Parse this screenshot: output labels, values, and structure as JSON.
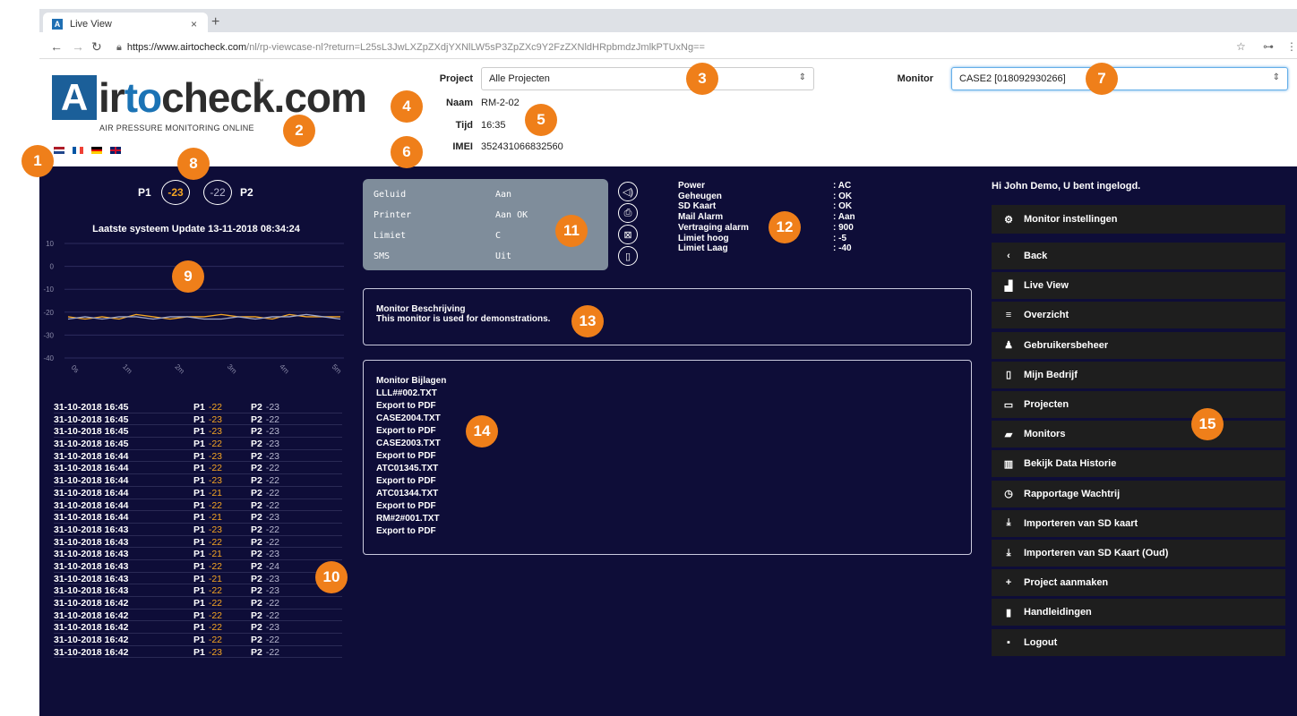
{
  "browser": {
    "tab_title": "Live View",
    "tab_favicon": "A",
    "url_domain": "https://www.airtocheck.com",
    "url_path": "/nl/rp-viewcase-nl?return=L25sL3JwLXZpZXdjYXNlLW5sP3ZpZXc9Y2FzZXNldHRpbmdzJmlkPTUxNg=="
  },
  "logo": {
    "prefix": "A",
    "name_a": "ir",
    "name_b": "to",
    "name_c": "check.com",
    "tm": "™",
    "tagline": "AIR PRESSURE MONITORING ONLINE"
  },
  "header": {
    "project_label": "Project",
    "project_value": "Alle Projecten",
    "monitor_label": "Monitor",
    "monitor_value": "CASE2 [018092930266]",
    "naam_label": "Naam",
    "naam_value": "RM-2-02",
    "tijd_label": "Tijd",
    "tijd_value": "16:35",
    "imei_label": "IMEI",
    "imei_value": "352431066832560"
  },
  "badges": [
    "1",
    "2",
    "3",
    "4",
    "5",
    "6",
    "7",
    "8",
    "9",
    "10",
    "11",
    "12",
    "13",
    "14",
    "15"
  ],
  "pressure": {
    "p1_label": "P1",
    "p1_value": "-23",
    "p2_value": "-22",
    "p2_label": "P2",
    "last_update": "Laatste systeem Update 13-11-2018 08:34:24"
  },
  "chart_data": {
    "type": "line",
    "y_ticks": [
      "10",
      "0",
      "-10",
      "-20",
      "-30",
      "-40"
    ],
    "x_ticks": [
      "0s",
      "1m",
      "2m",
      "3m",
      "4m",
      "5m"
    ],
    "ylim": [
      -40,
      10
    ],
    "series": [
      {
        "color": "#f5a623",
        "values": [
          -22,
          -23,
          -22,
          -23,
          -21,
          -22,
          -23,
          -22,
          -22,
          -21,
          -22,
          -22,
          -23,
          -21,
          -22,
          -22,
          -22
        ]
      },
      {
        "color": "#9fa7c8",
        "values": [
          -23,
          -22,
          -23,
          -22,
          -22,
          -23,
          -22,
          -22,
          -23,
          -23,
          -22,
          -23,
          -22,
          -22,
          -21,
          -22,
          -23
        ]
      }
    ]
  },
  "log": [
    {
      "dt": "31-10-2018 16:45",
      "p1": "-22",
      "p2": "-23"
    },
    {
      "dt": "31-10-2018 16:45",
      "p1": "-23",
      "p2": "-22"
    },
    {
      "dt": "31-10-2018 16:45",
      "p1": "-23",
      "p2": "-23"
    },
    {
      "dt": "31-10-2018 16:45",
      "p1": "-22",
      "p2": "-23"
    },
    {
      "dt": "31-10-2018 16:44",
      "p1": "-23",
      "p2": "-23"
    },
    {
      "dt": "31-10-2018 16:44",
      "p1": "-22",
      "p2": "-22"
    },
    {
      "dt": "31-10-2018 16:44",
      "p1": "-23",
      "p2": "-22"
    },
    {
      "dt": "31-10-2018 16:44",
      "p1": "-21",
      "p2": "-22"
    },
    {
      "dt": "31-10-2018 16:44",
      "p1": "-22",
      "p2": "-22"
    },
    {
      "dt": "31-10-2018 16:44",
      "p1": "-21",
      "p2": "-23"
    },
    {
      "dt": "31-10-2018 16:43",
      "p1": "-23",
      "p2": "-22"
    },
    {
      "dt": "31-10-2018 16:43",
      "p1": "-22",
      "p2": "-22"
    },
    {
      "dt": "31-10-2018 16:43",
      "p1": "-21",
      "p2": "-23"
    },
    {
      "dt": "31-10-2018 16:43",
      "p1": "-22",
      "p2": "-24"
    },
    {
      "dt": "31-10-2018 16:43",
      "p1": "-21",
      "p2": "-23"
    },
    {
      "dt": "31-10-2018 16:43",
      "p1": "-22",
      "p2": "-23"
    },
    {
      "dt": "31-10-2018 16:42",
      "p1": "-22",
      "p2": "-22"
    },
    {
      "dt": "31-10-2018 16:42",
      "p1": "-22",
      "p2": "-22"
    },
    {
      "dt": "31-10-2018 16:42",
      "p1": "-22",
      "p2": "-23"
    },
    {
      "dt": "31-10-2018 16:42",
      "p1": "-22",
      "p2": "-22"
    },
    {
      "dt": "31-10-2018 16:42",
      "p1": "-23",
      "p2": "-22"
    }
  ],
  "status": {
    "rows": [
      {
        "k": "Geluid",
        "v": "Aan"
      },
      {
        "k": "Printer",
        "v": "Aan OK"
      },
      {
        "k": "Limiet",
        "v": "C"
      },
      {
        "k": "SMS",
        "v": "Uit"
      }
    ],
    "icons": [
      "speaker-icon",
      "printer-icon",
      "limit-icon",
      "phone-icon"
    ]
  },
  "info": {
    "rows": [
      {
        "k": "Power",
        "v": ": AC"
      },
      {
        "k": "Geheugen",
        "v": ": OK"
      },
      {
        "k": "SD Kaart",
        "v": ": OK"
      },
      {
        "k": "Mail Alarm",
        "v": ": Aan"
      },
      {
        "k": "Vertraging alarm",
        "v": ": 900"
      },
      {
        "k": "Limiet hoog",
        "v": ": -5"
      },
      {
        "k": "Limiet Laag",
        "v": ": -40"
      }
    ]
  },
  "description": {
    "title": "Monitor Beschrijving",
    "text": "This monitor is used for demonstrations."
  },
  "attachments": {
    "title": "Monitor Bijlagen",
    "export_label": "Export to PDF",
    "files": [
      "LLL##002.TXT",
      "CASE2004.TXT",
      "CASE2003.TXT",
      "ATC01345.TXT",
      "ATC01344.TXT",
      "RM#2#001.TXT"
    ]
  },
  "sidebar": {
    "greeting": "Hi John Demo, U bent ingelogd.",
    "settings_label": "Monitor instellingen",
    "items": [
      {
        "icon": "‹",
        "label": "Back"
      },
      {
        "icon": "▟",
        "label": "Live View"
      },
      {
        "icon": "≡",
        "label": "Overzicht"
      },
      {
        "icon": "♟",
        "label": "Gebruikersbeheer"
      },
      {
        "icon": "▯",
        "label": "Mijn Bedrijf"
      },
      {
        "icon": "▭",
        "label": "Projecten"
      },
      {
        "icon": "▰",
        "label": "Monitors"
      },
      {
        "icon": "▥",
        "label": "Bekijk Data Historie"
      },
      {
        "icon": "◷",
        "label": "Rapportage Wachtrij"
      },
      {
        "icon": "⤓",
        "label": "Importeren van SD kaart"
      },
      {
        "icon": "⤓",
        "label": "Importeren van SD Kaart (Oud)"
      },
      {
        "icon": "+",
        "label": "Project aanmaken"
      },
      {
        "icon": "▮",
        "label": "Handleidingen"
      },
      {
        "icon": "▪",
        "label": "Logout"
      }
    ]
  }
}
